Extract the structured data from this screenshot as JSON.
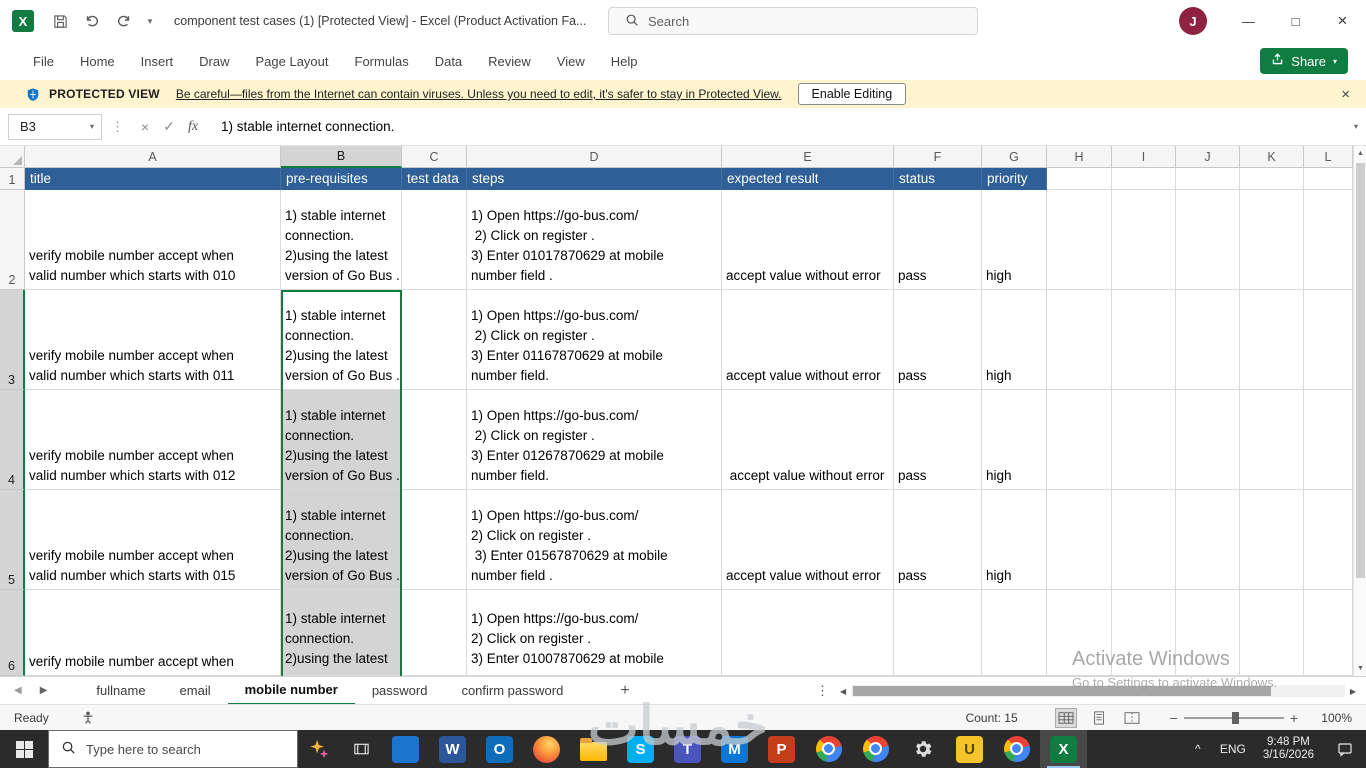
{
  "colors": {
    "excel_green": "#107C41",
    "header_blue": "#2E5F96",
    "selection_gray": "#D4D4D4",
    "banner_yellow": "#FFF4CE",
    "taskbar_dark": "#2B2B2B",
    "avatar_maroon": "#8E2240"
  },
  "icons": {
    "caret_down": "▾",
    "dots_vertical": "⋮",
    "cancel": "×",
    "check": "✓",
    "triangle_left": "◀",
    "triangle_right": "▶",
    "triangle_up": "▲",
    "triangle_down": "▼",
    "minimize": "—",
    "maximize": "□",
    "close": "×",
    "add": "+",
    "chevron_up": "^",
    "minus": "−",
    "plus": "+"
  },
  "titlebar": {
    "logo_glyph": "X",
    "app_title": "component test cases (1)  [Protected View] -  Excel (Product Activation Fa...",
    "search_label": "Search",
    "avatar_initial": "J"
  },
  "menubar": {
    "items": [
      "File",
      "Home",
      "Insert",
      "Draw",
      "Page Layout",
      "Formulas",
      "Data",
      "Review",
      "View",
      "Help"
    ],
    "share_label": "Share"
  },
  "protected_view": {
    "label": "PROTECTED VIEW",
    "message": "Be careful—files from the Internet can contain viruses. Unless you need to edit, it's safer to stay in Protected View.",
    "enable_button": "Enable Editing"
  },
  "formula_bar": {
    "name_box": "B3",
    "fx": "fx",
    "content": "1) stable internet connection."
  },
  "grid": {
    "columns": [
      "A",
      "B",
      "C",
      "D",
      "E",
      "F",
      "G",
      "H",
      "I",
      "J",
      "K",
      "L"
    ],
    "selected_column": "B",
    "rows_visible": [
      "1",
      "2",
      "3",
      "4",
      "5",
      "6"
    ],
    "header_cells": {
      "A": "title",
      "B": "pre-requisites",
      "C": "test data",
      "D": "steps",
      "E": "expected result",
      "F": "status",
      "G": "priority"
    },
    "data_rows": [
      {
        "n": "2",
        "title": "verify mobile number accept when\nvalid number which starts with 010",
        "prerequisites": "1) stable internet\nconnection.\n2)using the latest\nversion of Go Bus .",
        "test_data": "",
        "steps": "1) Open https://go-bus.com/\n 2) Click on register .\n3) Enter 01017870629 at mobile\nnumber field .",
        "expected_result": "accept value without error",
        "status": "pass",
        "priority": "high"
      },
      {
        "n": "3",
        "title": "verify mobile number accept when\nvalid number which starts with 011",
        "prerequisites": "1) stable internet\nconnection.\n2)using the latest\nversion of Go Bus .",
        "test_data": "",
        "steps": "1) Open https://go-bus.com/\n 2) Click on register .\n3) Enter 01167870629 at mobile\nnumber field.",
        "expected_result": "accept value without error",
        "status": "pass",
        "priority": "high"
      },
      {
        "n": "4",
        "title": "verify mobile number accept when\nvalid number which starts with 012",
        "prerequisites": "1) stable internet\nconnection.\n2)using the latest\nversion of Go Bus .",
        "test_data": "",
        "steps": "1) Open https://go-bus.com/\n 2) Click on register .\n3) Enter 01267870629 at mobile\nnumber field.",
        "expected_result": " accept value without error",
        "status": "pass",
        "priority": "high"
      },
      {
        "n": "5",
        "title": "verify mobile number accept when\nvalid number which starts with 015",
        "prerequisites": "1) stable internet\nconnection.\n2)using the latest\nversion of Go Bus .",
        "test_data": "",
        "steps": "1) Open https://go-bus.com/\n2) Click on register .\n 3) Enter 01567870629 at mobile\nnumber field .",
        "expected_result": "accept value without error",
        "status": "pass",
        "priority": "high"
      },
      {
        "n": "6",
        "title": "verify mobile number accept when",
        "prerequisites": "1) stable internet\nconnection.\n2)using the latest",
        "test_data": "",
        "steps": "1) Open https://go-bus.com/\n2) Click on register .\n3) Enter 01007870629 at mobile",
        "expected_result": "",
        "status": "",
        "priority": ""
      }
    ]
  },
  "sheet_tabs": {
    "tabs": [
      "fullname",
      "email",
      "mobile number",
      "password",
      "confirm password"
    ],
    "active": "mobile number"
  },
  "status_bar": {
    "mode": "Ready",
    "count": "Count: 15",
    "zoom": "100%"
  },
  "taskbar": {
    "search_label": "Type here to search",
    "apps": [
      {
        "name": "store",
        "glyph": ""
      },
      {
        "name": "word",
        "glyph": "W"
      },
      {
        "name": "outlook",
        "glyph": "O"
      },
      {
        "name": "firefox",
        "glyph": ""
      },
      {
        "name": "file-explorer",
        "glyph": ""
      },
      {
        "name": "skype",
        "glyph": "S"
      },
      {
        "name": "teams",
        "glyph": "T"
      },
      {
        "name": "mail",
        "glyph": "M"
      },
      {
        "name": "powerpoint",
        "glyph": "P"
      },
      {
        "name": "chrome-1",
        "glyph": ""
      },
      {
        "name": "chrome-2",
        "glyph": ""
      },
      {
        "name": "settings",
        "glyph": ""
      },
      {
        "name": "notes",
        "glyph": "U"
      },
      {
        "name": "chrome-3",
        "glyph": ""
      },
      {
        "name": "excel",
        "glyph": "X"
      }
    ],
    "tray": {
      "lang": "ENG",
      "time": "9:48 PM",
      "date": "3/16/2026"
    }
  },
  "watermarks": {
    "activate_line1": "Activate Windows",
    "activate_line2": "Go to Settings to activate Windows.",
    "site": "خمسات"
  }
}
